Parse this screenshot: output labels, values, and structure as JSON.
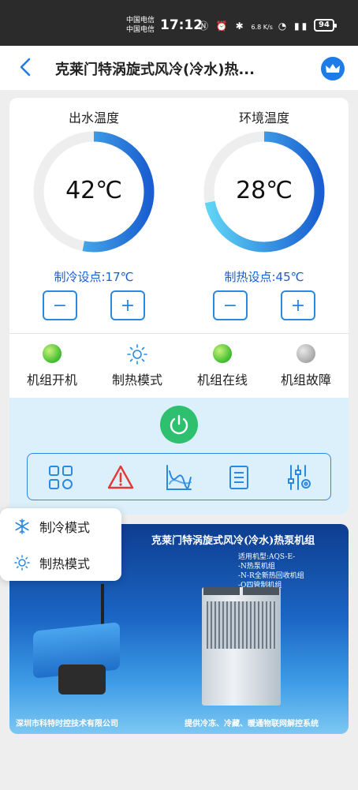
{
  "status_bar": {
    "carrier1": "中国电信",
    "carrier2": "中国电信",
    "time": "17:12",
    "net_speed": "6.8 K/s",
    "battery": "94"
  },
  "header": {
    "title": "克莱门特涡旋式风冷(冷水)热..."
  },
  "gauges": [
    {
      "label": "出水温度",
      "value": "42℃",
      "setpoint": "制冷设点:17℃",
      "fill": 0.53
    },
    {
      "label": "环境温度",
      "value": "28℃",
      "setpoint": "制热设点:45℃",
      "fill": 0.72
    }
  ],
  "stepper": {
    "minus": "−",
    "plus": "+"
  },
  "status_items": [
    {
      "label": "机组开机",
      "color": "#3dbb2e"
    },
    {
      "label": "制热模式",
      "color": "#2a8ae0"
    },
    {
      "label": "机组在线",
      "color": "#3dbb2e"
    },
    {
      "label": "机组故障",
      "color": "#a8a8a8"
    }
  ],
  "toolbar_icons": [
    "grid-icon",
    "alarm-warning-icon",
    "trend-chart-icon",
    "document-list-icon",
    "sliders-settings-icon"
  ],
  "popup": {
    "items": [
      {
        "label": "制冷模式",
        "icon": "snowflake-icon"
      },
      {
        "label": "制热模式",
        "icon": "sun-icon"
      }
    ]
  },
  "banner": {
    "title": "克莱门特涡旋式风冷(冷水)热泵机组",
    "model_lines": [
      "适用机型:AQS-E-",
      "-N热泵机组",
      "-N-R全新热回收机组",
      "-Q四管制机组"
    ],
    "footer_left": "深圳市科特时控技术有限公司",
    "footer_right": "提供冷冻、冷藏、暖通物联网解控系统"
  },
  "colors": {
    "accent": "#2a8ae0",
    "gauge_dark": "#1a5fd1",
    "gauge_light": "#5fd4f5",
    "power": "#2ec06f",
    "alert": "#e53935"
  }
}
